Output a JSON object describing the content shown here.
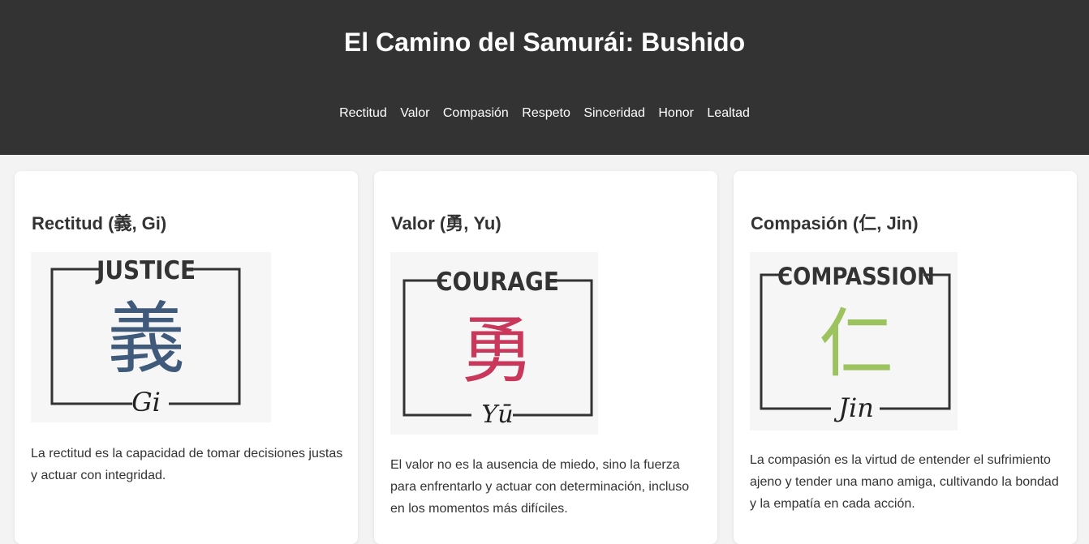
{
  "header": {
    "title": "El Camino del Samurái: Bushido",
    "nav": [
      "Rectitud",
      "Valor",
      "Compasión",
      "Respeto",
      "Sinceridad",
      "Honor",
      "Lealtad"
    ]
  },
  "cards": [
    {
      "title": "Rectitud (義, Gi)",
      "virtue_en": "JUSTICE",
      "kanji": "義",
      "romaji": "Gi",
      "kanji_color": "#3f5a7a",
      "text": "La rectitud es la capacidad de tomar decisiones justas y actuar con integridad."
    },
    {
      "title": "Valor (勇, Yu)",
      "virtue_en": "COURAGE",
      "kanji": "勇",
      "romaji": "Yū",
      "kanji_color": "#c9385a",
      "text": "El valor no es la ausencia de miedo, sino la fuerza para enfrentarlo y actuar con determinación, incluso en los momentos más difíciles."
    },
    {
      "title": "Compasión (仁, Jin)",
      "virtue_en": "COMPASSION",
      "kanji": "仁",
      "romaji": "Jin",
      "kanji_color": "#9cc35f",
      "text": "La compasión es la virtud de entender el sufrimiento ajeno y tender una mano amiga, cultivando la bondad y la empatía en cada acción."
    }
  ]
}
